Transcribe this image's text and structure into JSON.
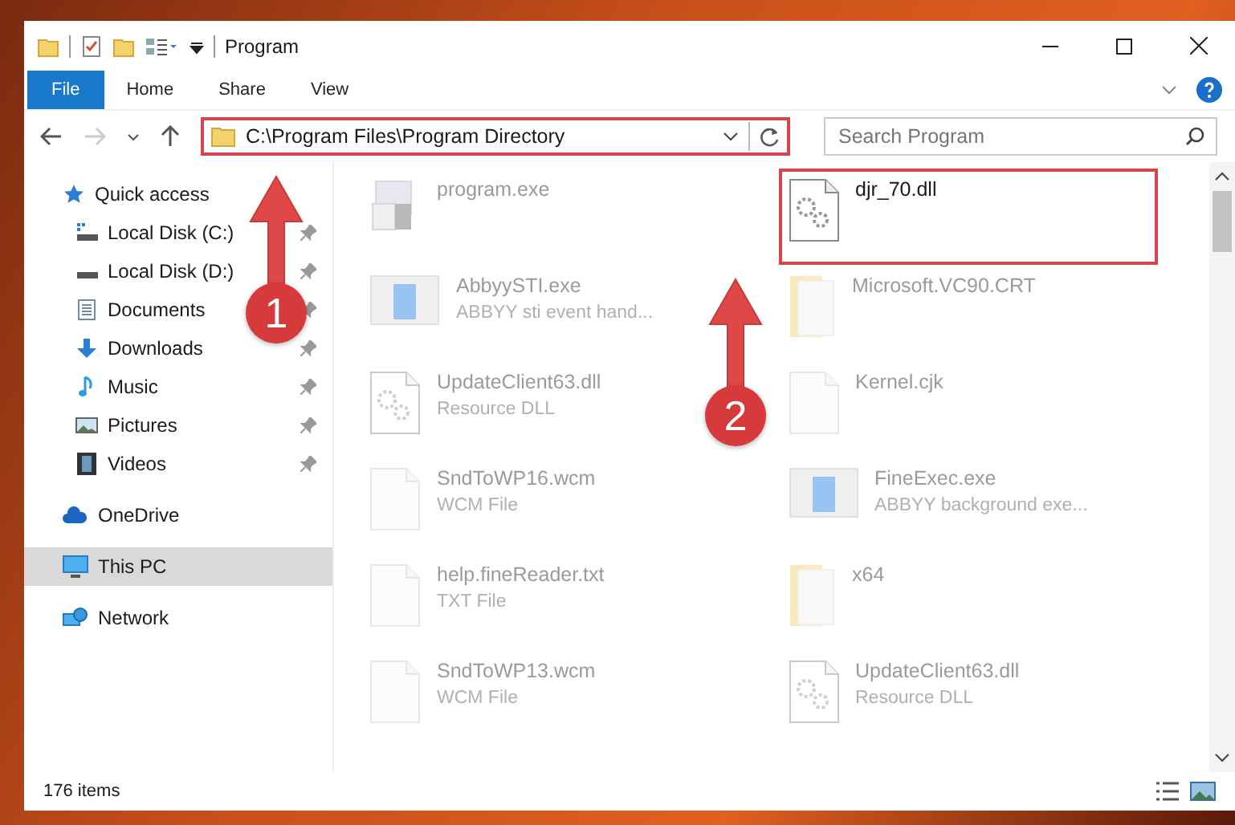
{
  "window": {
    "title": "Program"
  },
  "ribbon_tabs": [
    {
      "label": "File",
      "selected": true
    },
    {
      "label": "Home",
      "selected": false
    },
    {
      "label": "Share",
      "selected": false
    },
    {
      "label": "View",
      "selected": false
    }
  ],
  "address": {
    "value": "C:\\Program Files\\Program Directory",
    "highlighted": true
  },
  "search": {
    "placeholder": "Search Program"
  },
  "sidebar": {
    "items": [
      {
        "label": "Quick access",
        "kind": "star",
        "pinned": false,
        "selected": false,
        "children": [
          {
            "label": "Local Disk (C:)",
            "kind": "disk-c",
            "pinned": true,
            "selected": false
          },
          {
            "label": "Local Disk (D:)",
            "kind": "disk",
            "pinned": true,
            "selected": false
          },
          {
            "label": "Documents",
            "kind": "documents",
            "pinned": true,
            "selected": false
          },
          {
            "label": "Downloads",
            "kind": "downloads",
            "pinned": true,
            "selected": false
          },
          {
            "label": "Music",
            "kind": "music",
            "pinned": true,
            "selected": false
          },
          {
            "label": "Pictures",
            "kind": "pictures",
            "pinned": true,
            "selected": false
          },
          {
            "label": "Videos",
            "kind": "videos",
            "pinned": true,
            "selected": false
          }
        ]
      },
      {
        "label": "OneDrive",
        "kind": "cloud",
        "pinned": false,
        "selected": false
      },
      {
        "label": "This PC",
        "kind": "pc",
        "pinned": false,
        "selected": true
      },
      {
        "label": "Network",
        "kind": "network",
        "pinned": false,
        "selected": false
      }
    ]
  },
  "files": [
    {
      "name": "program.exe",
      "kind": "app",
      "blurred": true,
      "highlighted": false
    },
    {
      "name": "djr_70.dll",
      "kind": "dll",
      "blurred": false,
      "highlighted": true
    },
    {
      "name": "AbbyySTI.exe",
      "detail": "ABBYY sti event hand...",
      "kind": "window",
      "blurred": true,
      "highlighted": false
    },
    {
      "name": "Microsoft.VC90.CRT",
      "kind": "folder",
      "blurred": true,
      "highlighted": false
    },
    {
      "name": "UpdateClient63.dll",
      "detail": "Resource DLL",
      "kind": "dll",
      "blurred": true,
      "highlighted": false
    },
    {
      "name": "Kernel.cjk",
      "kind": "blank",
      "blurred": true,
      "highlighted": false
    },
    {
      "name": "SndToWP16.wcm",
      "detail": "WCM File",
      "kind": "blank",
      "blurred": true,
      "highlighted": false
    },
    {
      "name": "FineExec.exe",
      "detail": "ABBYY background exe...",
      "kind": "window",
      "blurred": true,
      "highlighted": false
    },
    {
      "name": "help.fineReader.txt",
      "detail": "TXT File",
      "kind": "blank",
      "blurred": true,
      "highlighted": false
    },
    {
      "name": "x64",
      "kind": "folder",
      "blurred": true,
      "highlighted": false
    },
    {
      "name": "SndToWP13.wcm",
      "detail": "WCM File",
      "kind": "blank",
      "blurred": true,
      "highlighted": false
    },
    {
      "name": "UpdateClient63.dll",
      "detail": "Resource DLL",
      "kind": "dll",
      "blurred": true,
      "highlighted": false
    }
  ],
  "status_bar": {
    "count": "176 items"
  },
  "callouts": [
    "1",
    "2"
  ]
}
